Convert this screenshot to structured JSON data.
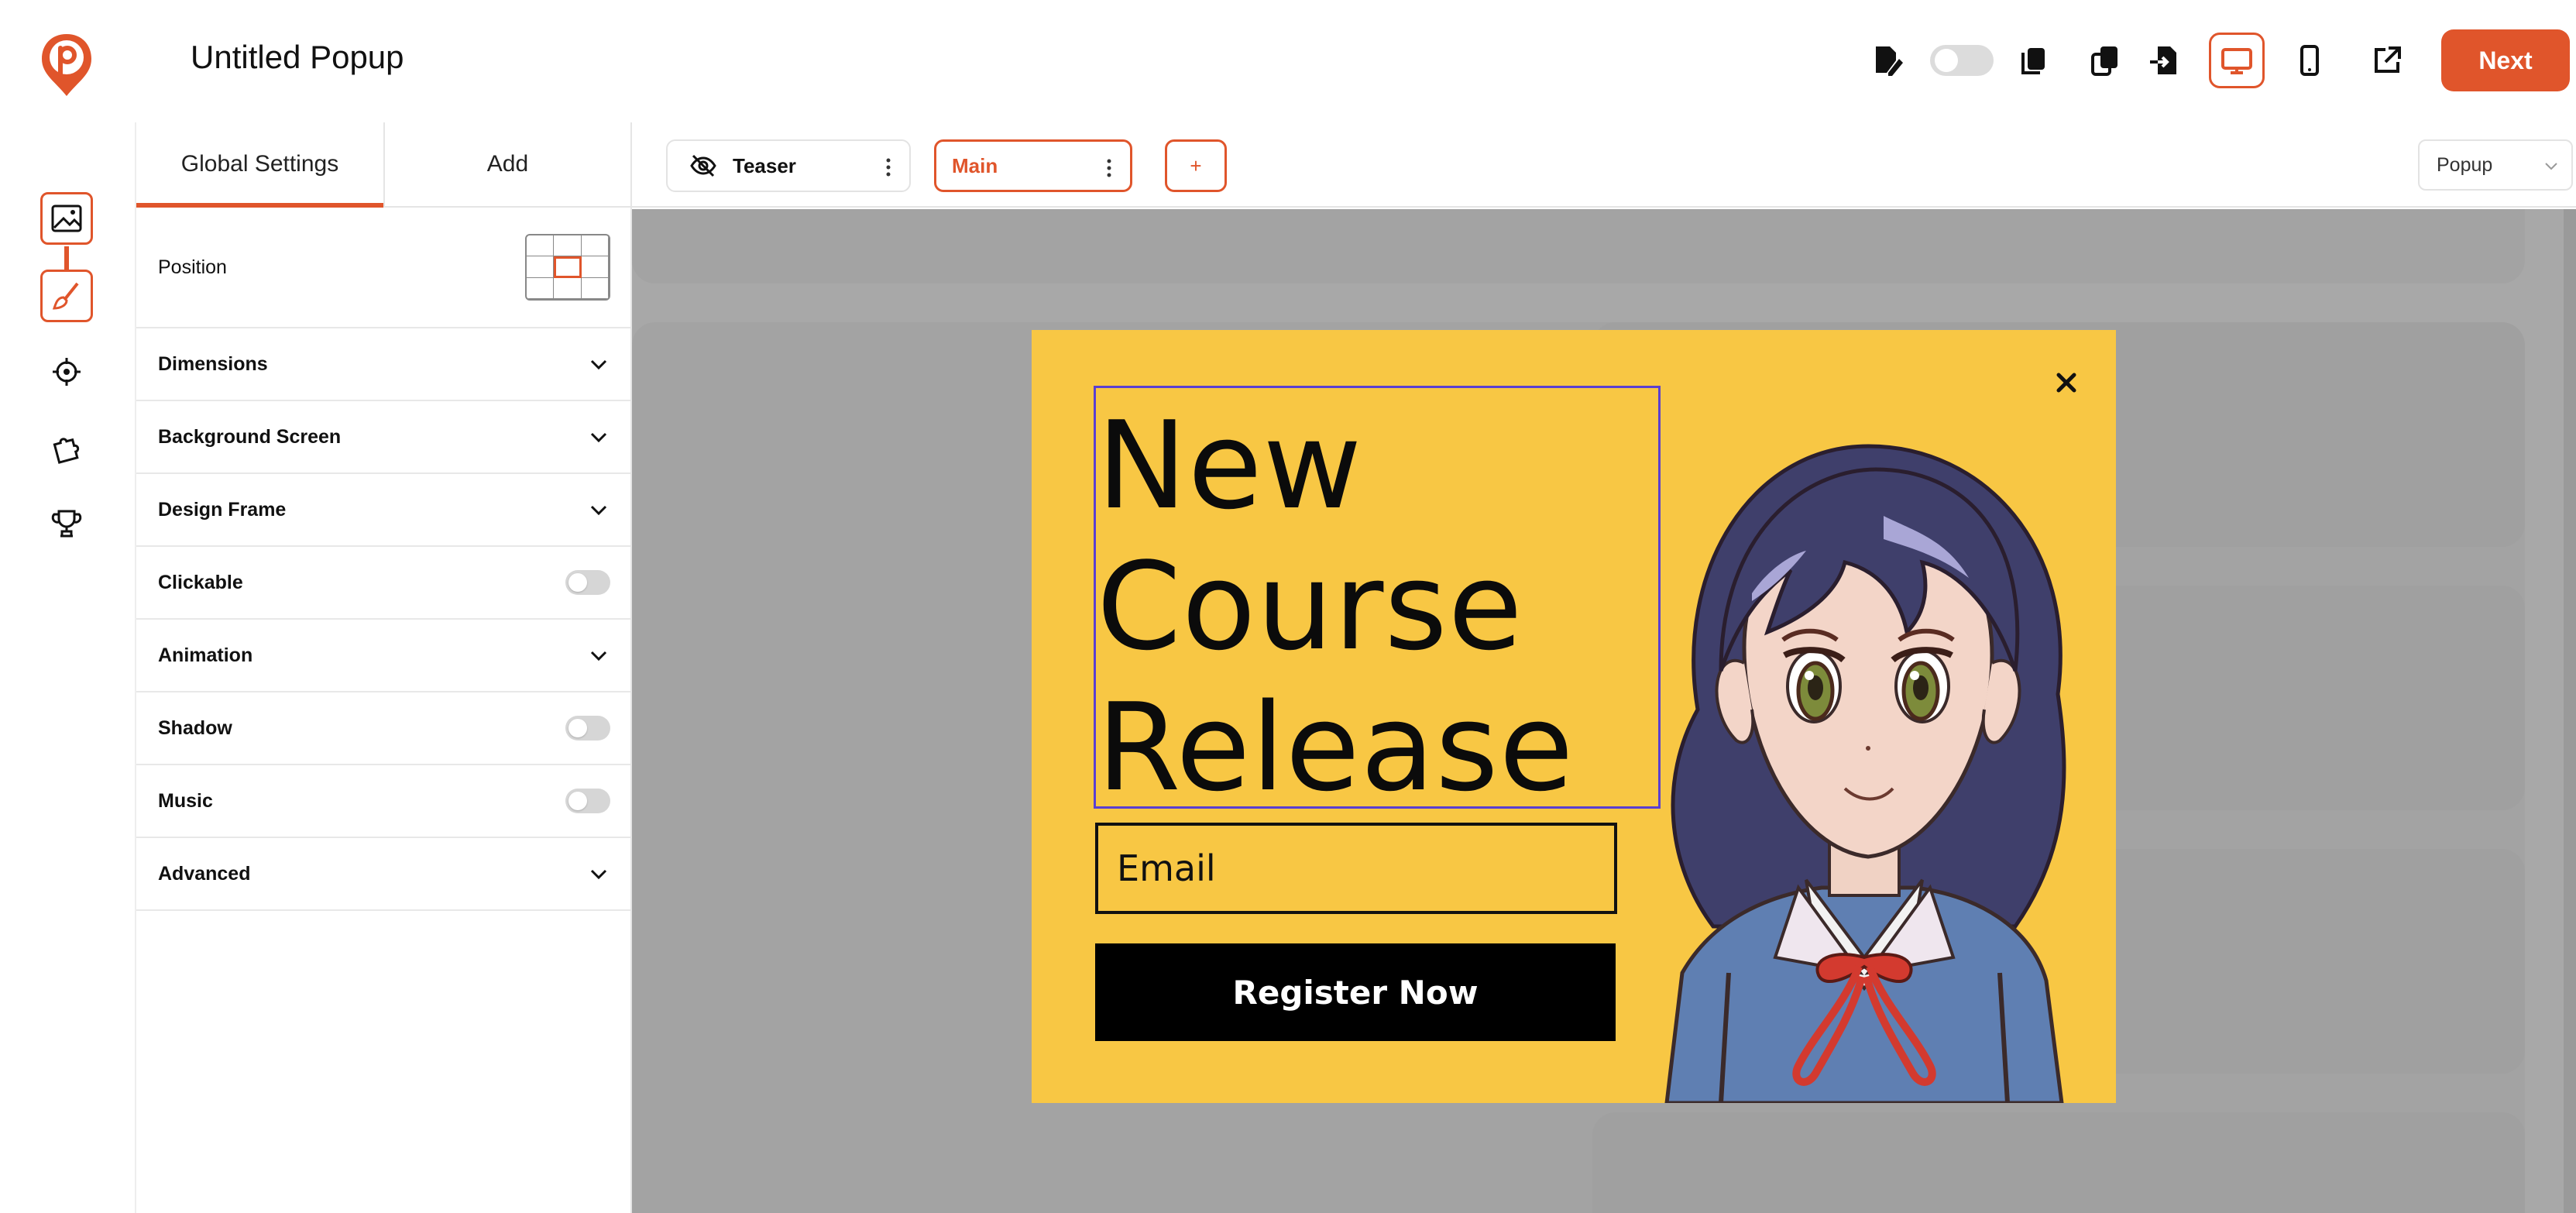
{
  "app": {
    "title": "Untitled Popup"
  },
  "toolbar": {
    "next_label": "Next",
    "icons": [
      "edit-icon",
      "toggle",
      "copy-icon",
      "duplicate-icon",
      "export-icon",
      "desktop-icon",
      "mobile-icon",
      "external-link-icon"
    ]
  },
  "rail": {
    "icons": [
      "image-icon",
      "brush-icon",
      "target-icon",
      "puzzle-icon",
      "trophy-icon"
    ]
  },
  "panel": {
    "tabs": [
      {
        "label": "Global Settings"
      },
      {
        "label": "Add"
      }
    ],
    "position_label": "Position",
    "rows": [
      {
        "label": "Dimensions",
        "control": "chevron"
      },
      {
        "label": "Background Screen",
        "control": "chevron"
      },
      {
        "label": "Design Frame",
        "control": "chevron"
      },
      {
        "label": "Clickable",
        "control": "switch"
      },
      {
        "label": "Animation",
        "control": "chevron"
      },
      {
        "label": "Shadow",
        "control": "switch"
      },
      {
        "label": "Music",
        "control": "switch"
      },
      {
        "label": "Advanced",
        "control": "chevron"
      }
    ]
  },
  "steps": {
    "teaser": "Teaser",
    "main": "Main",
    "add": "+"
  },
  "view_select": {
    "value": "Popup"
  },
  "popup": {
    "headline_lines": [
      "New",
      "Course",
      "Release"
    ],
    "email_placeholder": "Email",
    "cta_label": "Register Now",
    "close_symbol": "×"
  },
  "colors": {
    "accent": "#e0552b",
    "popup_bg": "#f8c744",
    "stage_bg": "#a8a8a8",
    "selection": "#5b3fd1"
  }
}
